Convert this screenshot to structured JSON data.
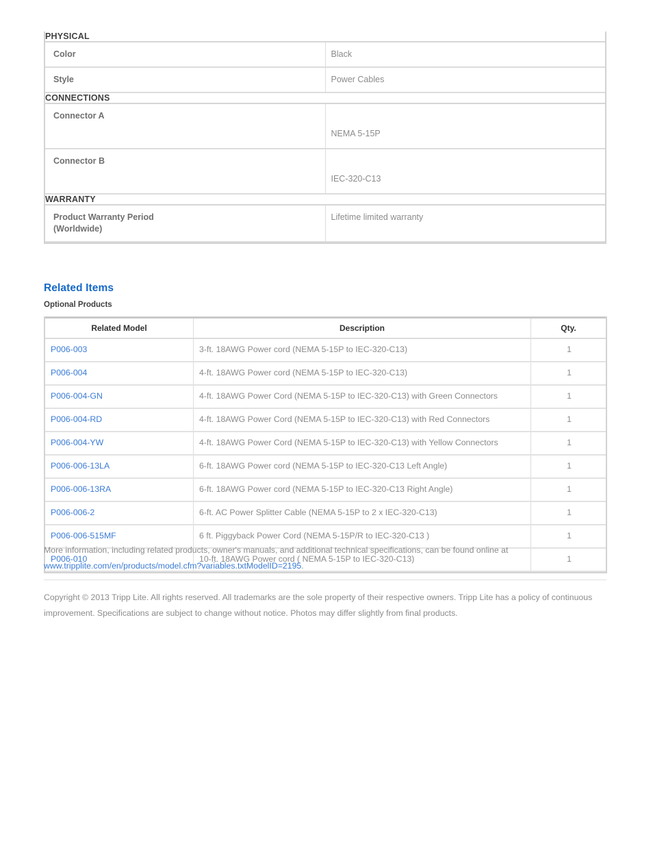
{
  "spec_table": {
    "sections": [
      {
        "heading": "PHYSICAL",
        "rows": [
          {
            "key": "Color",
            "value": "Black",
            "tall": false
          },
          {
            "key": "Style",
            "value": "Power Cables",
            "tall": false
          }
        ]
      },
      {
        "heading": "CONNECTIONS",
        "rows": [
          {
            "key": "Connector A",
            "value": "NEMA 5-15P",
            "tall": true
          },
          {
            "key": "Connector B",
            "value": "IEC-320-C13",
            "tall": true
          }
        ]
      },
      {
        "heading": "WARRANTY",
        "rows": [
          {
            "key": "Product Warranty Period (Worldwide)",
            "value": "Lifetime limited warranty",
            "tall": false
          }
        ]
      }
    ],
    "rows_flat": {
      "color_key": "Color",
      "color_value": "Black",
      "style_key": "Style",
      "style_value": "Power Cables",
      "connector_a_key": "Connector A",
      "connector_a_value": "NEMA 5-15P",
      "connector_b_key": "Connector B",
      "connector_b_value": "IEC-320-C13",
      "warranty_key_line1": "Product Warranty Period",
      "warranty_key_line2": "(Worldwide)",
      "warranty_value": "Lifetime limited warranty"
    },
    "headings": {
      "physical": "PHYSICAL",
      "connections": "CONNECTIONS",
      "warranty": "WARRANTY"
    }
  },
  "related": {
    "section_title": "Related Items",
    "subsection_title": "Optional Products",
    "columns": [
      "Related Model",
      "Description",
      "Qty."
    ],
    "column_labels": {
      "model": "Related Model",
      "description": "Description",
      "qty": "Qty."
    },
    "rows": [
      {
        "model": "P006-003",
        "description": "3-ft. 18AWG Power cord (NEMA 5-15P to IEC-320-C13)",
        "qty": "1"
      },
      {
        "model": "P006-004",
        "description": "4-ft. 18AWG Power cord (NEMA 5-15P to IEC-320-C13)",
        "qty": "1"
      },
      {
        "model": "P006-004-GN",
        "description": "4-ft. 18AWG Power Cord (NEMA 5-15P to IEC-320-C13) with Green Connectors",
        "qty": "1"
      },
      {
        "model": "P006-004-RD",
        "description": "4-ft. 18AWG Power Cord (NEMA 5-15P to IEC-320-C13) with Red Connectors",
        "qty": "1"
      },
      {
        "model": "P006-004-YW",
        "description": "4-ft. 18AWG Power Cord (NEMA 5-15P to IEC-320-C13) with Yellow Connectors",
        "qty": "1"
      },
      {
        "model": "P006-006-13LA",
        "description": "6-ft. 18AWG Power cord (NEMA 5-15P to IEC-320-C13 Left Angle)",
        "qty": "1"
      },
      {
        "model": "P006-006-13RA",
        "description": "6-ft. 18AWG Power cord (NEMA 5-15P to IEC-320-C13 Right Angle)",
        "qty": "1"
      },
      {
        "model": "P006-006-2",
        "description": "6-ft. AC Power Splitter Cable (NEMA 5-15P to 2 x IEC-320-C13)",
        "qty": "1"
      },
      {
        "model": "P006-006-515MF",
        "description": "6 ft. Piggyback Power Cord (NEMA 5-15P/R to IEC-320-C13 )",
        "qty": "1"
      },
      {
        "model": "P006-010",
        "description": "10-ft. 18AWG Power cord ( NEMA 5-15P to IEC-320-C13)",
        "qty": "1"
      }
    ]
  },
  "footer": {
    "more_info_text": "More information, including related products, owner's manuals, and additional technical specifications, can be found online at",
    "more_info_link": "www.tripplite.com/en/products/model.cfm?variables.txtModelID=2195",
    "more_info_period": ".",
    "copyright": "Copyright © 2013 Tripp Lite. All rights reserved. All trademarks are the sole property of their respective owners. Tripp Lite has a policy of continuous improvement. Specifications are subject to change without notice. Photos may differ slightly from final products."
  },
  "colors": {
    "heading_blue": "#1569c7",
    "link_blue": "#3a7bd5",
    "body_gray": "#8b8b8b",
    "key_gray": "#6f6f6f",
    "border_gray": "#dcdcdc",
    "outer_border": "#d2d2d2"
  }
}
